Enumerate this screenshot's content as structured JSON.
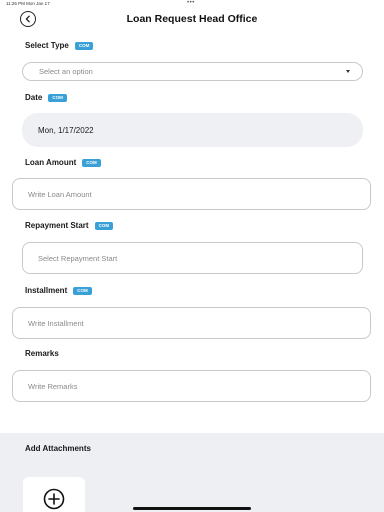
{
  "status_bar": {
    "time": "11:26 PM   Mon Jan 17",
    "dots": "•••"
  },
  "header": {
    "title": "Loan Request Head Office"
  },
  "badge_text": "COM",
  "select_type": {
    "label": "Select Type",
    "placeholder": "Select an option"
  },
  "date": {
    "label": "Date",
    "value": "Mon, 1/17/2022"
  },
  "loan_amount": {
    "label": "Loan Amount",
    "placeholder": "Write Loan Amount"
  },
  "repayment_start": {
    "label": "Repayment Start",
    "placeholder": "Select Repayment Start"
  },
  "installment": {
    "label": "Installment",
    "placeholder": "Write Installment"
  },
  "remarks": {
    "label": "Remarks",
    "placeholder": "Write Remarks"
  },
  "attachments": {
    "title": "Add Attachments"
  },
  "colors": {
    "badge": "#3aa0d8",
    "date_bg": "#eff0f4",
    "section_bg": "#eeeff3"
  },
  "icons": [
    "back-arrow-icon",
    "dropdown-caret-icon",
    "add-circle-icon"
  ]
}
